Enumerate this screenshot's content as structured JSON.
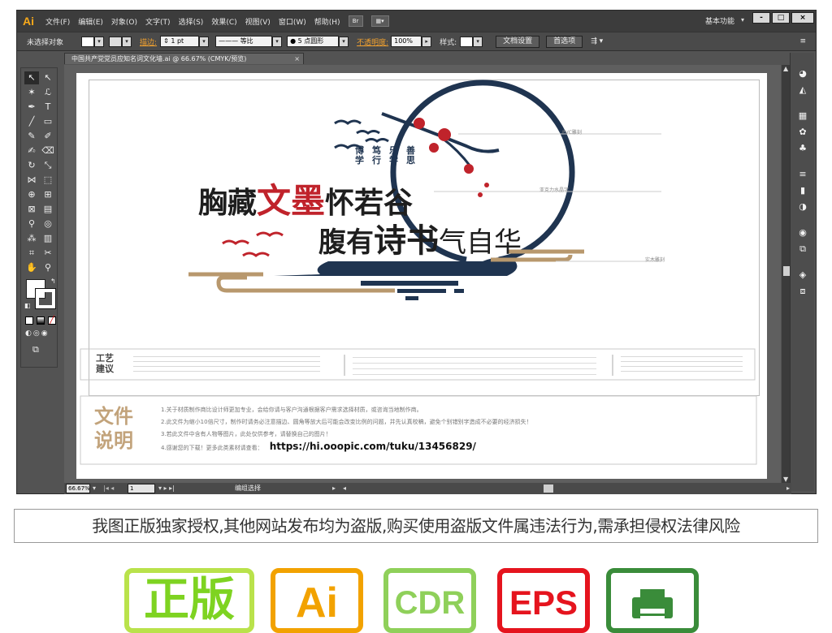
{
  "menubar": {
    "app_icon": "Ai",
    "items": [
      "文件(F)",
      "编辑(E)",
      "对象(O)",
      "文字(T)",
      "选择(S)",
      "效果(C)",
      "视图(V)",
      "窗口(W)",
      "帮助(H)"
    ],
    "bridge_button": "Br",
    "workspace": "基本功能",
    "window_buttons": [
      "-",
      "□",
      "×"
    ]
  },
  "controlbar": {
    "selection_label": "未选择对象",
    "stroke_label": "描边:",
    "stroke_value": "1 pt",
    "stroke_style": "等比",
    "brush_value": "5 点圆形",
    "opacity_label": "不透明度:",
    "opacity_value": "100%",
    "style_label": "样式:",
    "doc_setup_button": "文档设置",
    "preferences_button": "首选项"
  },
  "document": {
    "tab_title": "中国共产党党员应知名词文化墙.ai @ 66.67% (CMYK/预览)",
    "tab_close": "×"
  },
  "artwork": {
    "line1_a": "胸藏",
    "line1_b": "文墨",
    "line1_c": "怀若谷",
    "line2_a": "腹有",
    "line2_b": "诗书",
    "line2_c": "气自华",
    "vertical_words": [
      "博学",
      "笃行",
      "乐学",
      "善思"
    ],
    "annotation_pvc": "PVC雕刻",
    "annotation_acrylic": "亚克力水晶字",
    "annotation_wood": "实木雕刻",
    "craft_title": "工艺\n建议",
    "file_title": "文件\n说明",
    "notes": [
      "1.关于材质制作商比设计师更加专业，会给你请与客户沟通根据客户需求选择材质，或咨询当地制作商。",
      "2.此文件为缩小10倍尺寸，制作时请务必注意描边、圆角等放大后可能会改变比例的问题，并先认真校稿，避免个别错别字造成不必要的经济损失！",
      "3.若此文件中含有人物等图片，此处仅供参考，请替换自己的图片！",
      "4.感谢您的下载！更多此类素材请查看："
    ],
    "url": "https://hi.ooopic.com/tuku/13456829/"
  },
  "statusbar": {
    "zoom": "66.67%",
    "page": "1",
    "status": "编组选择"
  },
  "notice": "我图正版独家授权,其他网站发布均为盗版,购买使用盗版文件属违法行为,需承担侵权法律风险",
  "badges": {
    "genuine": "正版",
    "ai": "Ai",
    "cdr": "CDR",
    "eps": "EPS"
  },
  "colors": {
    "navy": "#1f3450",
    "red": "#c0232b",
    "gold": "#b8986d",
    "ui_dark": "#535353",
    "orange_ai": "#f2a200",
    "green_cdr": "#8fd05a",
    "red_eps": "#e5141e",
    "green_print": "#3a8c3a"
  }
}
